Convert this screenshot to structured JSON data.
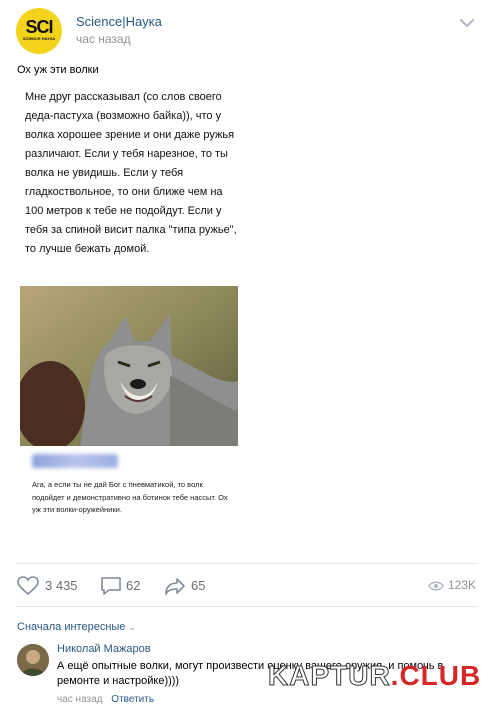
{
  "post": {
    "group_name": "Science|Наука",
    "time": "час назад",
    "avatar_text": "SCI",
    "avatar_sub": "SCIENCE НАУКА",
    "text": "Ох уж эти волки"
  },
  "meme": {
    "story": "Мне друг рассказывал (со слов своего деда-пастуха (возможно байка)), что у волка хорошее зрение и они даже ружья различают. Если у тебя нарезное, то ты волка не увидишь. Если у тебя гладкоствольное, то они ближе чем на 100 метров к тебе не подойдут. Если у тебя за спиной висит палка \"типа ружье\", то лучше бежать домой.",
    "reply_text": "Ага, а если ты не дай Бог с пневматикой, то волк подойдет и демонстративно на ботинок тебе нассыт. Ох уж эти волки-оружейники."
  },
  "actions": {
    "likes": "3 435",
    "comments": "62",
    "shares": "65",
    "views": "123K"
  },
  "comments": {
    "sort_label": "Сначала интересные",
    "items": [
      {
        "author": "Николай Мажаров",
        "text": "А ещё опытные волки, могут произвести оценку вашего оружия, и помочь в ремонте и настройке))))",
        "time": "час назад",
        "reply_label": "Ответить"
      }
    ]
  },
  "watermark": {
    "part1": "KAPTUR",
    "part2": ".CLUB"
  },
  "colors": {
    "link": "#2a5885",
    "muted": "#939393",
    "avatar_yellow": "#f4d31d"
  }
}
